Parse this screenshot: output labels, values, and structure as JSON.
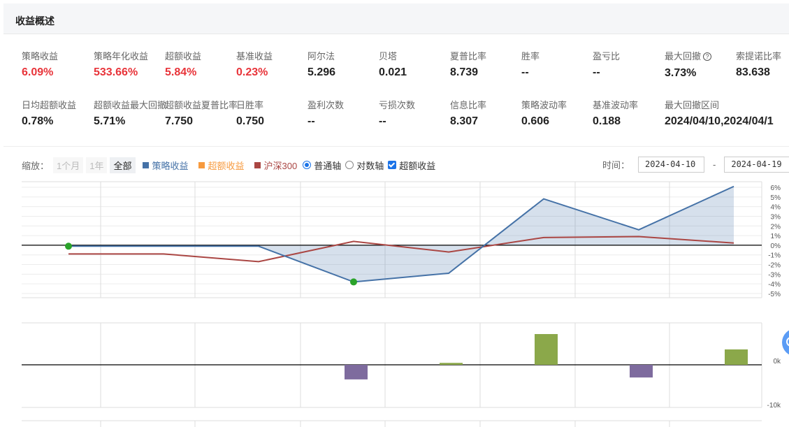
{
  "header": {
    "title": "收益概述"
  },
  "metrics_row1": [
    {
      "label": "策略收益",
      "value": "6.09%",
      "red": true
    },
    {
      "label": "策略年化收益",
      "value": "533.66%",
      "red": true
    },
    {
      "label": "超额收益",
      "value": "5.84%",
      "red": true
    },
    {
      "label": "基准收益",
      "value": "0.23%",
      "red": true
    },
    {
      "label": "阿尔法",
      "value": "5.296"
    },
    {
      "label": "贝塔",
      "value": "0.021"
    },
    {
      "label": "夏普比率",
      "value": "8.739"
    },
    {
      "label": "胜率",
      "value": "--"
    },
    {
      "label": "盈亏比",
      "value": "--"
    },
    {
      "label": "最大回撤",
      "value": "3.73%",
      "help": "?"
    },
    {
      "label": "索提诺比率",
      "value": "83.638"
    }
  ],
  "metrics_row2": [
    {
      "label": "日均超额收益",
      "value": "0.78%"
    },
    {
      "label": "超额收益最大回撤",
      "value": "5.71%"
    },
    {
      "label": "超额收益夏普比率",
      "value": "7.750"
    },
    {
      "label": "日胜率",
      "value": "0.750"
    },
    {
      "label": "盈利次数",
      "value": "--"
    },
    {
      "label": "亏损次数",
      "value": "--"
    },
    {
      "label": "信息比率",
      "value": "8.307"
    },
    {
      "label": "策略波动率",
      "value": "0.606"
    },
    {
      "label": "基准波动率",
      "value": "0.188"
    },
    {
      "label": "最大回撤区间",
      "value": "2024/04/10,2024/04/1"
    }
  ],
  "controls": {
    "zoom_label": "缩放：",
    "zoom_options": [
      "1个月",
      "1年",
      "全部"
    ],
    "legend": [
      {
        "name": "策略收益",
        "color": "#4572a7"
      },
      {
        "name": "超额收益",
        "color": "#f79a3e"
      },
      {
        "name": "沪深300",
        "color": "#aa4643"
      }
    ],
    "axis_normal": "普通轴",
    "axis_log": "对数轴",
    "excess_check": "超额收益",
    "time_label": "时间：",
    "date_from": "2024-04-10",
    "date_to": "2024-04-19",
    "date_sep": "-"
  },
  "chart_data": {
    "type": "line",
    "ylim": [
      -5,
      6
    ],
    "yticks": [
      "6%",
      "5%",
      "4%",
      "3%",
      "2%",
      "1%",
      "0%",
      "-1%",
      "-2%",
      "-3%",
      "-4%",
      "-5%"
    ],
    "series": [
      {
        "name": "策略收益",
        "color": "#4572a7",
        "values": [
          -0.1,
          -0.1,
          -0.1,
          -3.8,
          -2.9,
          4.8,
          1.6,
          6.09
        ]
      },
      {
        "name": "沪深300",
        "color": "#aa4643",
        "values": [
          -0.9,
          -0.9,
          -1.7,
          0.4,
          -0.7,
          0.8,
          0.9,
          0.23
        ]
      }
    ],
    "markers": [
      0,
      3
    ],
    "sub_chart": {
      "type": "bar",
      "ylim": [
        -10000,
        10000
      ],
      "yticks": [
        "0k",
        "-10k"
      ],
      "values": [
        0,
        0,
        0,
        -3800,
        500,
        8000,
        -3300,
        4000
      ],
      "colors": {
        "positive": "#8ba84a",
        "negative": "#7e6b9e"
      }
    }
  }
}
